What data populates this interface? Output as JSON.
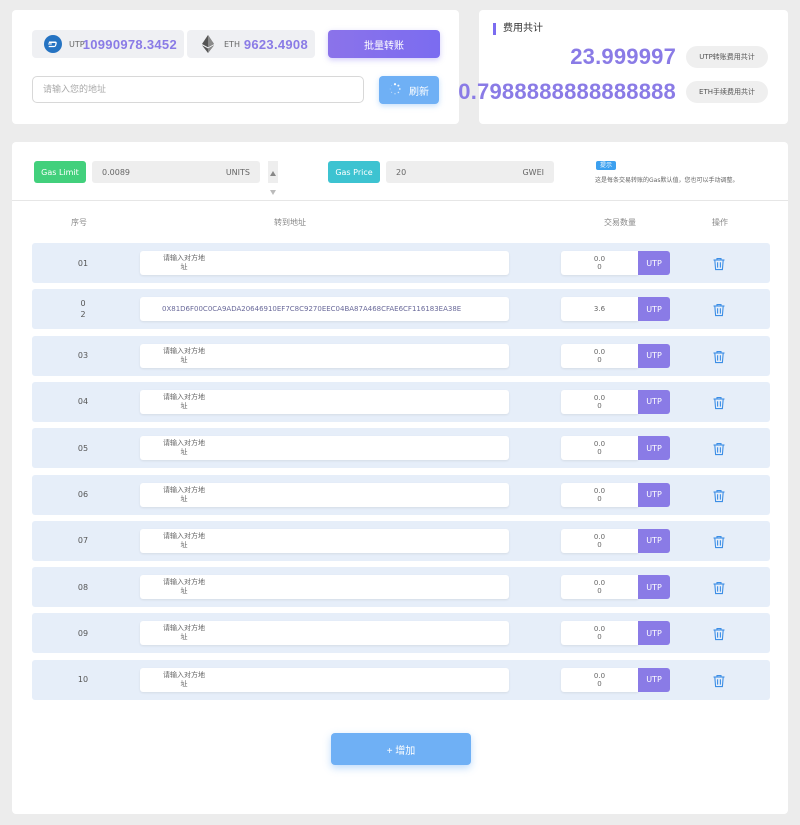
{
  "wallet": {
    "utp": {
      "currency": "UTP",
      "amount": "10990978.3452",
      "icon": "dash-coin-icon"
    },
    "eth": {
      "currency": "ETH",
      "amount": "9623.4908",
      "icon": "ethereum-icon"
    },
    "batch_transfer_label": "批量转账",
    "address_placeholder": "请输入您的地址",
    "refresh_label": "刷新"
  },
  "fees": {
    "title": "费用共计",
    "utp_total": "23.999997",
    "utp_total_label": "UTP转账费用共计",
    "eth_total": "0.7988888888888888",
    "eth_total_label": "ETH手续费用共计"
  },
  "gas": {
    "limit_label": "Gas Limit",
    "limit_value": "0.0089",
    "limit_unit": "UNITS",
    "price_label": "Gas Price",
    "price_value": "20",
    "price_unit": "GWEI",
    "hint_badge": "提示",
    "hint_text": "这是每条交易转账的Gas默认值，您也可以手动调整。"
  },
  "table": {
    "headers": {
      "index": "序号",
      "address": "转到地址",
      "amount": "交易数量",
      "action": "操作"
    },
    "address_placeholder": "请输入对方地址",
    "rows": [
      {
        "index": "01",
        "address": "",
        "amount": "0.0\n0",
        "unit": "UTP"
      },
      {
        "index": "0\n2",
        "address": "0X81D6F00C0CA9ADA20646910EF7C8C9270EEC04BA87A468CFAE6CF116183EA38E",
        "amount": "3.6",
        "unit": "UTP"
      },
      {
        "index": "03",
        "address": "",
        "amount": "0.0\n0",
        "unit": "UTP"
      },
      {
        "index": "04",
        "address": "",
        "amount": "0.0\n0",
        "unit": "UTP"
      },
      {
        "index": "05",
        "address": "",
        "amount": "0.0\n0",
        "unit": "UTP"
      },
      {
        "index": "06",
        "address": "",
        "amount": "0.0\n0",
        "unit": "UTP"
      },
      {
        "index": "07",
        "address": "",
        "amount": "0.0\n0",
        "unit": "UTP"
      },
      {
        "index": "08",
        "address": "",
        "amount": "0.0\n0",
        "unit": "UTP"
      },
      {
        "index": "09",
        "address": "",
        "amount": "0.0\n0",
        "unit": "UTP"
      },
      {
        "index": "10",
        "address": "",
        "amount": "0.0\n0",
        "unit": "UTP"
      }
    ]
  },
  "add_label": "+ 增加",
  "colors": {
    "accent_purple": "#8a7be6",
    "accent_blue": "#6fb0f5",
    "gas_limit_green": "#42d07c",
    "gas_price_teal": "#3dc3d1",
    "row_bg": "#e6eef9"
  }
}
